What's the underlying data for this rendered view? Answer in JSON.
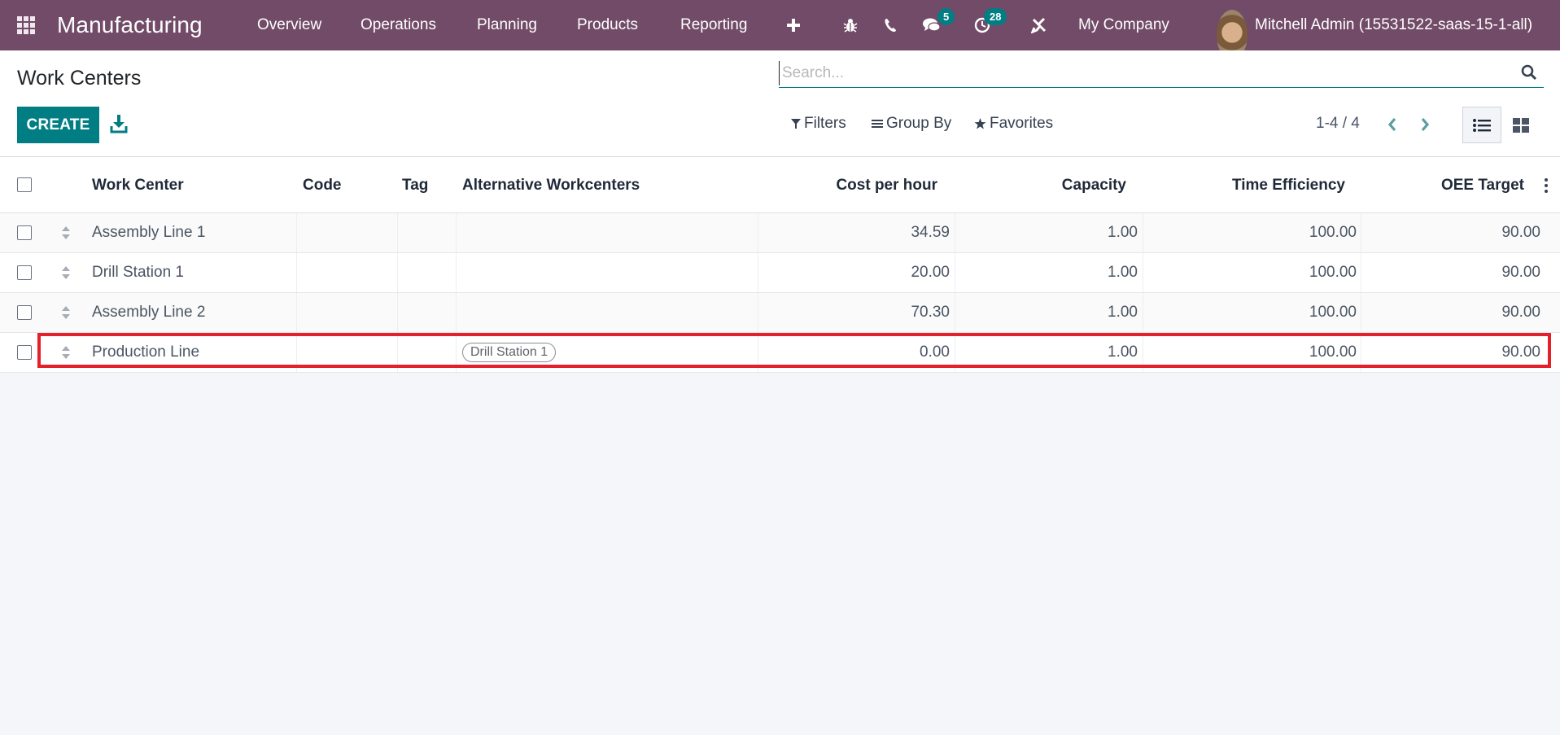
{
  "navbar": {
    "app_name": "Manufacturing",
    "menu": [
      "Overview",
      "Operations",
      "Planning",
      "Products",
      "Reporting"
    ],
    "icons": [
      "plus-icon",
      "bug-icon",
      "phone-icon",
      "chat-icon",
      "activity-clock-icon",
      "tools-icon"
    ],
    "messages_badge": "5",
    "activities_badge": "28",
    "company": "My Company",
    "user": "Mitchell Admin (15531522-saas-15-1-all)"
  },
  "control_panel": {
    "title": "Work Centers",
    "create_label": "CREATE",
    "search_placeholder": "Search...",
    "filters_label": "Filters",
    "group_by_label": "Group By",
    "favorites_label": "Favorites",
    "pager": "1-4 / 4"
  },
  "table": {
    "columns": [
      "Work Center",
      "Code",
      "Tag",
      "Alternative Workcenters",
      "Cost per hour",
      "Capacity",
      "Time Efficiency",
      "OEE Target"
    ],
    "rows": [
      {
        "work_center": "Assembly Line 1",
        "code": "",
        "tag": "",
        "alternatives": "",
        "cost_per_hour": "34.59",
        "capacity": "1.00",
        "time_efficiency": "100.00",
        "oee_target": "90.00"
      },
      {
        "work_center": "Drill Station 1",
        "code": "",
        "tag": "",
        "alternatives": "",
        "cost_per_hour": "20.00",
        "capacity": "1.00",
        "time_efficiency": "100.00",
        "oee_target": "90.00"
      },
      {
        "work_center": "Assembly Line 2",
        "code": "",
        "tag": "",
        "alternatives": "",
        "cost_per_hour": "70.30",
        "capacity": "1.00",
        "time_efficiency": "100.00",
        "oee_target": "90.00"
      },
      {
        "work_center": "Production Line",
        "code": "",
        "tag": "",
        "alternatives": "Drill Station 1",
        "cost_per_hour": "0.00",
        "capacity": "1.00",
        "time_efficiency": "100.00",
        "oee_target": "90.00",
        "highlighted": true
      }
    ]
  },
  "colors": {
    "navbar": "#714b67",
    "primary": "#017e84",
    "highlight": "#e6202a"
  }
}
